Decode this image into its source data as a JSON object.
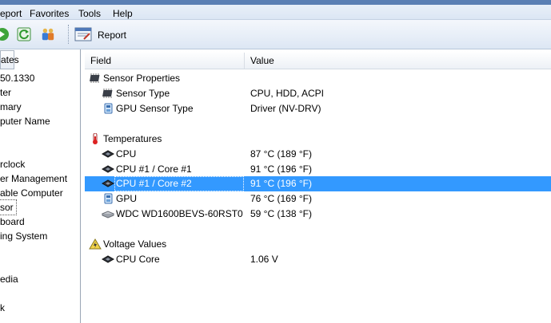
{
  "menu": [
    "eport",
    "Favorites",
    "Tools",
    "Help"
  ],
  "toolbar": {
    "report_label": "Report"
  },
  "left_panel": {
    "header": "ates",
    "items": [
      "50.1330",
      "ter",
      "mary",
      "puter Name",
      "",
      "",
      "rclock",
      "er Management",
      "able Computer",
      "sor",
      "board",
      "ing System",
      "",
      "",
      "edia",
      "",
      "k"
    ]
  },
  "list": {
    "columns": [
      "Field",
      "Value"
    ],
    "groups": [
      {
        "label": "Sensor Properties",
        "icon": "chip-icon",
        "rows": [
          {
            "field": "Sensor Type",
            "value": "CPU, HDD, ACPI",
            "icon": "chip-icon"
          },
          {
            "field": "GPU Sensor Type",
            "value": "Driver  (NV-DRV)",
            "icon": "gpu-driver-icon"
          }
        ]
      },
      {
        "label": "Temperatures",
        "icon": "thermometer-icon",
        "rows": [
          {
            "field": "CPU",
            "value": "87 °C  (189 °F)",
            "icon": "cpu-icon"
          },
          {
            "field": "CPU #1 / Core #1",
            "value": "91 °C  (196 °F)",
            "icon": "cpu-icon"
          },
          {
            "field": "CPU #1 / Core #2",
            "value": "91 °C  (196 °F)",
            "icon": "cpu-icon",
            "selected": true
          },
          {
            "field": "GPU",
            "value": "76 °C  (169 °F)",
            "icon": "gpu-icon"
          },
          {
            "field": "WDC WD1600BEVS-60RST0",
            "value": "59 °C  (138 °F)",
            "icon": "hdd-icon"
          }
        ]
      },
      {
        "label": "Voltage Values",
        "icon": "voltage-warning-icon",
        "rows": [
          {
            "field": "CPU Core",
            "value": "1.06 V",
            "icon": "cpu-icon"
          }
        ]
      }
    ]
  },
  "colors": {
    "selection": "#3399ff",
    "menubar_top": "#5b7fb4"
  }
}
